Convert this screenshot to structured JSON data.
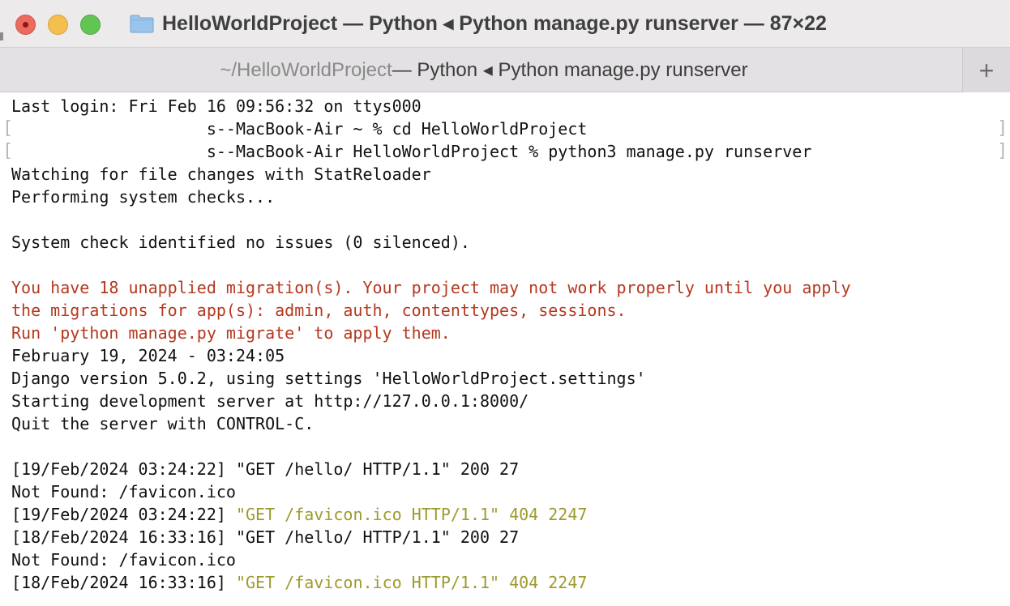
{
  "window": {
    "title": "HelloWorldProject — Python ◂ Python manage.py runserver — 87×22",
    "title_icon": "folder-icon"
  },
  "tab": {
    "dir": "~/HelloWorldProject",
    "rest": " — Python ◂ Python manage.py runserver",
    "new_tab_label": "+"
  },
  "colors": {
    "warning_red": "#b5381f",
    "request_yellow": "#9d9a2e",
    "text": "#111111"
  },
  "terminal": {
    "lines": [
      {
        "text": "Last login: Fri Feb 16 09:56:32 on ttys000"
      },
      {
        "text": "                    s--MacBook-Air ~ % cd HelloWorldProject",
        "mark": true
      },
      {
        "text": "                    s--MacBook-Air HelloWorldProject % python3 manage.py runserver",
        "mark": true
      },
      {
        "text": "Watching for file changes with StatReloader"
      },
      {
        "text": "Performing system checks..."
      },
      {
        "text": ""
      },
      {
        "text": "System check identified no issues (0 silenced)."
      },
      {
        "text": ""
      },
      {
        "text": "You have 18 unapplied migration(s). Your project may not work properly until you apply",
        "color": "red"
      },
      {
        "text": "the migrations for app(s): admin, auth, contenttypes, sessions.",
        "color": "red"
      },
      {
        "text": "Run 'python manage.py migrate' to apply them.",
        "color": "red"
      },
      {
        "text": "February 19, 2024 - 03:24:05"
      },
      {
        "text": "Django version 5.0.2, using settings 'HelloWorldProject.settings'"
      },
      {
        "text": "Starting development server at http://127.0.0.1:8000/"
      },
      {
        "text": "Quit the server with CONTROL-C."
      },
      {
        "text": ""
      },
      {
        "text": "[19/Feb/2024 03:24:22] \"GET /hello/ HTTP/1.1\" 200 27"
      },
      {
        "text": "Not Found: /favicon.ico"
      },
      {
        "prefix": "[19/Feb/2024 03:24:22] ",
        "text": "\"GET /favicon.ico HTTP/1.1\" 404 2247",
        "color": "yellow"
      },
      {
        "text": "[18/Feb/2024 16:33:16] \"GET /hello/ HTTP/1.1\" 200 27"
      },
      {
        "text": "Not Found: /favicon.ico"
      },
      {
        "prefix": "[18/Feb/2024 16:33:16] ",
        "text": "\"GET /favicon.ico HTTP/1.1\" 404 2247",
        "color": "yellow"
      }
    ]
  }
}
